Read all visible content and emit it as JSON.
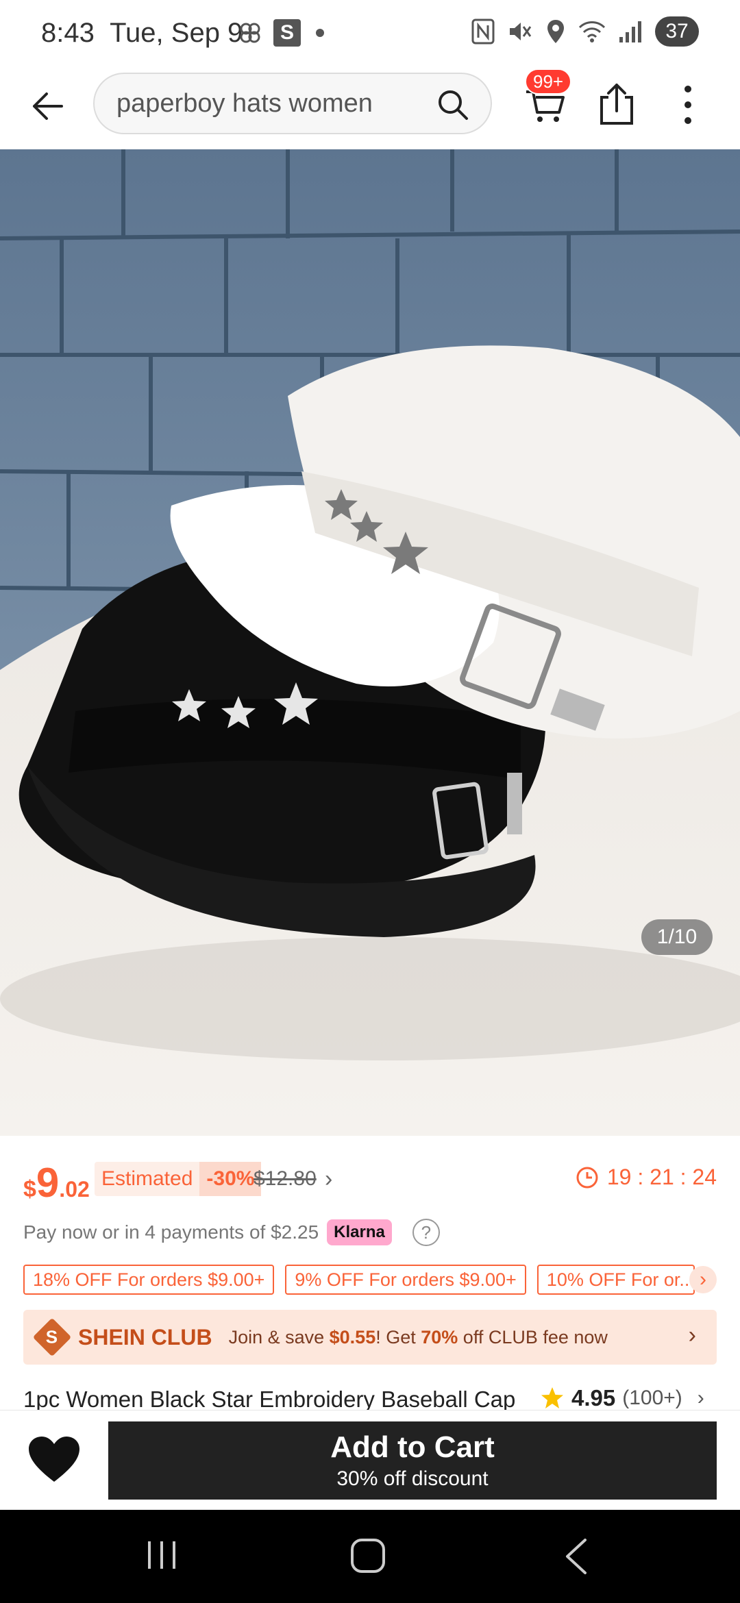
{
  "status_bar": {
    "time": "8:43",
    "date": "Tue, Sep 9",
    "app_badge": "S",
    "battery": "37"
  },
  "header": {
    "search_query": "paperboy hats women",
    "cart_badge": "99+"
  },
  "gallery": {
    "counter": "1/10"
  },
  "price": {
    "currency": "$",
    "integer": "9",
    "decimal": ".02",
    "estimated_label": "Estimated",
    "discount": "-30%",
    "original": "$12.80",
    "countdown": "19 : 21 : 24"
  },
  "payment": {
    "text": "Pay now or in 4 payments of $2.25",
    "provider": "Klarna",
    "help": "?"
  },
  "coupons": [
    "18% OFF For orders $9.00+",
    "9% OFF For orders $9.00+",
    "10% OFF For or..."
  ],
  "club": {
    "logo": "S",
    "title": "SHEIN CLUB",
    "text_prefix": "Join & save ",
    "save_amount": "$0.55",
    "text_mid": "! Get ",
    "percent": "70%",
    "text_suffix": " off CLUB fee now"
  },
  "product": {
    "title": "1pc Women Black Star Embroidery Baseball Cap",
    "rating": "4.95",
    "review_count": "(100+)"
  },
  "action_bar": {
    "add_to_cart": "Add to Cart",
    "subtitle": "30% off discount"
  },
  "colors": {
    "accent": "#fa6338",
    "club_text": "#c44e1a",
    "button_dark": "#222222",
    "badge_red": "#ff3b30",
    "klarna_pink": "#ffa8cd"
  },
  "icons": [
    "back-arrow-icon",
    "search-icon",
    "cart-icon",
    "share-icon",
    "more-vertical-icon",
    "clock-icon",
    "help-icon",
    "chevron-right-icon",
    "star-icon",
    "heart-icon"
  ]
}
